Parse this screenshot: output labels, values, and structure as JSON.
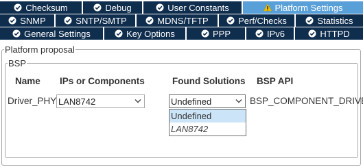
{
  "tabs": {
    "row1": [
      {
        "label": "Checksum",
        "icon": "check-circle-icon",
        "active": false
      },
      {
        "label": "Debug",
        "icon": "check-circle-icon",
        "active": false
      },
      {
        "label": "User Constants",
        "icon": "check-circle-icon",
        "active": false
      },
      {
        "label": "Platform Settings",
        "icon": "warning-triangle-icon",
        "active": true
      }
    ],
    "row2": [
      {
        "label": "SNMP",
        "icon": "check-circle-icon"
      },
      {
        "label": "SNTP/SMTP",
        "icon": "check-circle-icon"
      },
      {
        "label": "MDNS/TFTP",
        "icon": "check-circle-icon"
      },
      {
        "label": "Perf/Checks",
        "icon": "check-circle-icon"
      },
      {
        "label": "Statistics",
        "icon": "check-circle-icon"
      }
    ],
    "row3": [
      {
        "label": "General Settings",
        "icon": "check-circle-icon"
      },
      {
        "label": "Key Options",
        "icon": "check-circle-icon"
      },
      {
        "label": "PPP",
        "icon": "check-circle-icon"
      },
      {
        "label": "IPv6",
        "icon": "check-circle-icon"
      },
      {
        "label": "HTTPD",
        "icon": "check-circle-icon"
      }
    ]
  },
  "platform_group_label": "Platform proposal",
  "bsp_group_label": "BSP",
  "columns": {
    "name": "Name",
    "ips": "IPs or Components",
    "found": "Found Solutions",
    "api": "BSP API"
  },
  "row": {
    "name": "Driver_PHY",
    "ip_value": "LAN8742",
    "found_value": "Undefined",
    "api": "BSP_COMPONENT_DRIVER"
  },
  "dropdown_options": [
    "Undefined",
    "LAN8742"
  ],
  "colors": {
    "tab_bg": "#0f2d4d",
    "tab_active_bg": "#5aa0d8",
    "warning_yellow": "#f2c200",
    "selected_option": "#cce4f7"
  }
}
